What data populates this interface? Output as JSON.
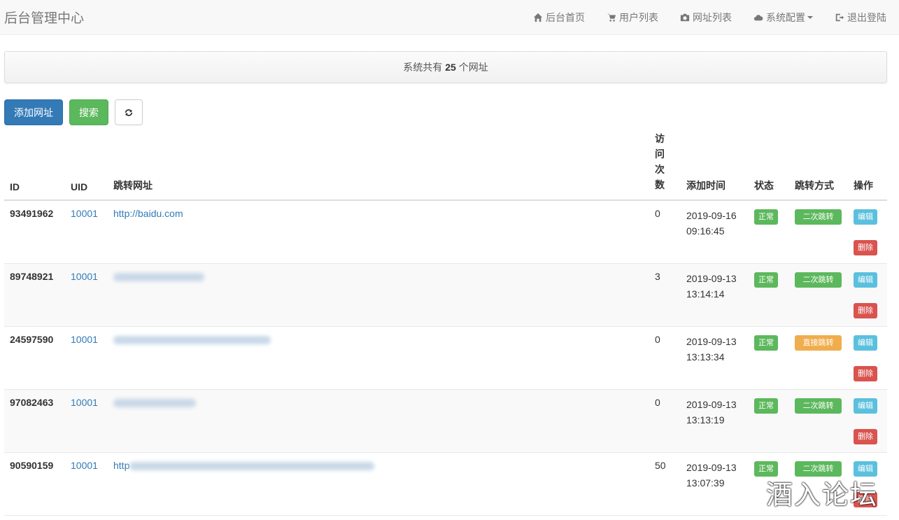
{
  "navbar": {
    "brand": "后台管理中心",
    "items": [
      {
        "label": "后台首页",
        "icon": "home-icon"
      },
      {
        "label": "用户列表",
        "icon": "cart-icon"
      },
      {
        "label": "网址列表",
        "icon": "camera-icon"
      },
      {
        "label": "系统配置",
        "icon": "cloud-icon"
      },
      {
        "label": "退出登陆",
        "icon": "logout-icon"
      }
    ]
  },
  "summary": {
    "prefix": "系统共有",
    "count": "25",
    "suffix": "个网址"
  },
  "toolbar": {
    "add_label": "添加网址",
    "search_label": "搜索",
    "refresh_icon": "refresh-icon"
  },
  "table": {
    "headers": {
      "id": "ID",
      "uid": "UID",
      "url": "跳转网址",
      "visits": "访问次数",
      "time": "添加时间",
      "status": "状态",
      "mode": "跳转方式",
      "actions": "操作"
    },
    "visits_chars": [
      "访",
      "问",
      "次",
      "数"
    ],
    "rows": [
      {
        "id": "93491962",
        "uid": "10001",
        "url": "http://baidu.com",
        "visits": "0",
        "date": "2019-09-16",
        "clock": "09:16:45",
        "status": "正常",
        "mode": "二次跳转",
        "mode_color": "success",
        "edit": "编辑",
        "del": "删除"
      },
      {
        "id": "89748921",
        "uid": "10001",
        "url": "",
        "visits": "3",
        "date": "2019-09-13",
        "clock": "13:14:14",
        "status": "正常",
        "mode": "二次跳转",
        "mode_color": "success",
        "edit": "编辑",
        "del": "删除"
      },
      {
        "id": "24597590",
        "uid": "10001",
        "url": "",
        "visits": "0",
        "date": "2019-09-13",
        "clock": "13:13:34",
        "status": "正常",
        "mode": "直接跳转",
        "mode_color": "warning",
        "edit": "编辑",
        "del": "删除"
      },
      {
        "id": "97082463",
        "uid": "10001",
        "url": "",
        "visits": "0",
        "date": "2019-09-13",
        "clock": "13:13:19",
        "status": "正常",
        "mode": "二次跳转",
        "mode_color": "success",
        "edit": "编辑",
        "del": "删除"
      },
      {
        "id": "90590159",
        "uid": "10001",
        "url": "http",
        "visits": "50",
        "date": "2019-09-13",
        "clock": "13:07:39",
        "status": "正常",
        "mode": "二次跳转",
        "mode_color": "success",
        "edit": "编辑",
        "del": "删除"
      }
    ]
  },
  "watermark": "酒入论坛",
  "colors": {
    "primary": "#337ab7",
    "success": "#5cb85c",
    "warning": "#f0ad4e",
    "info": "#5bc0de",
    "danger": "#d9534f"
  }
}
